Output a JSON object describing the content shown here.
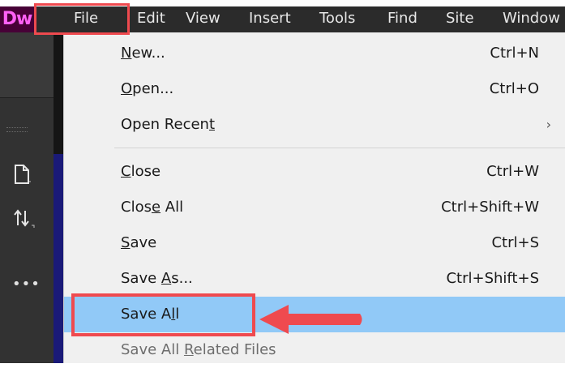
{
  "app": {
    "logo_text": "Dw",
    "accent_color": "#ff61f6"
  },
  "menubar": {
    "items": [
      {
        "label": "File"
      },
      {
        "label": "Edit"
      },
      {
        "label": "View"
      },
      {
        "label": "Insert"
      },
      {
        "label": "Tools"
      },
      {
        "label": "Find"
      },
      {
        "label": "Site"
      },
      {
        "label": "Window"
      }
    ]
  },
  "file_menu": {
    "items": [
      {
        "label": "New...",
        "mnemonic_index": 0,
        "shortcut": "Ctrl+N"
      },
      {
        "label": "Open...",
        "mnemonic_index": 0,
        "shortcut": "Ctrl+O"
      },
      {
        "label": "Open Recent",
        "mnemonic_index": 10,
        "shortcut": "",
        "submenu": true
      },
      {
        "label": "Close",
        "mnemonic_index": 0,
        "shortcut": "Ctrl+W"
      },
      {
        "label": "Close All",
        "mnemonic_index": 4,
        "shortcut": "Ctrl+Shift+W"
      },
      {
        "label": "Save",
        "mnemonic_index": 0,
        "shortcut": "Ctrl+S"
      },
      {
        "label": "Save As...",
        "mnemonic_index": 5,
        "shortcut": "Ctrl+Shift+S"
      },
      {
        "label": "Save All",
        "mnemonic_index": 6,
        "shortcut": "",
        "highlighted": true
      },
      {
        "label": "Save All Related Files",
        "mnemonic_index": 9,
        "shortcut": "",
        "disabled": true
      }
    ],
    "submenu_glyph": "›"
  },
  "left_panel": {
    "icons": [
      "file-icon",
      "sort-icon",
      "more-icon"
    ],
    "more_glyph": "•••"
  },
  "annotations": {
    "color": "#ef4a4f"
  }
}
